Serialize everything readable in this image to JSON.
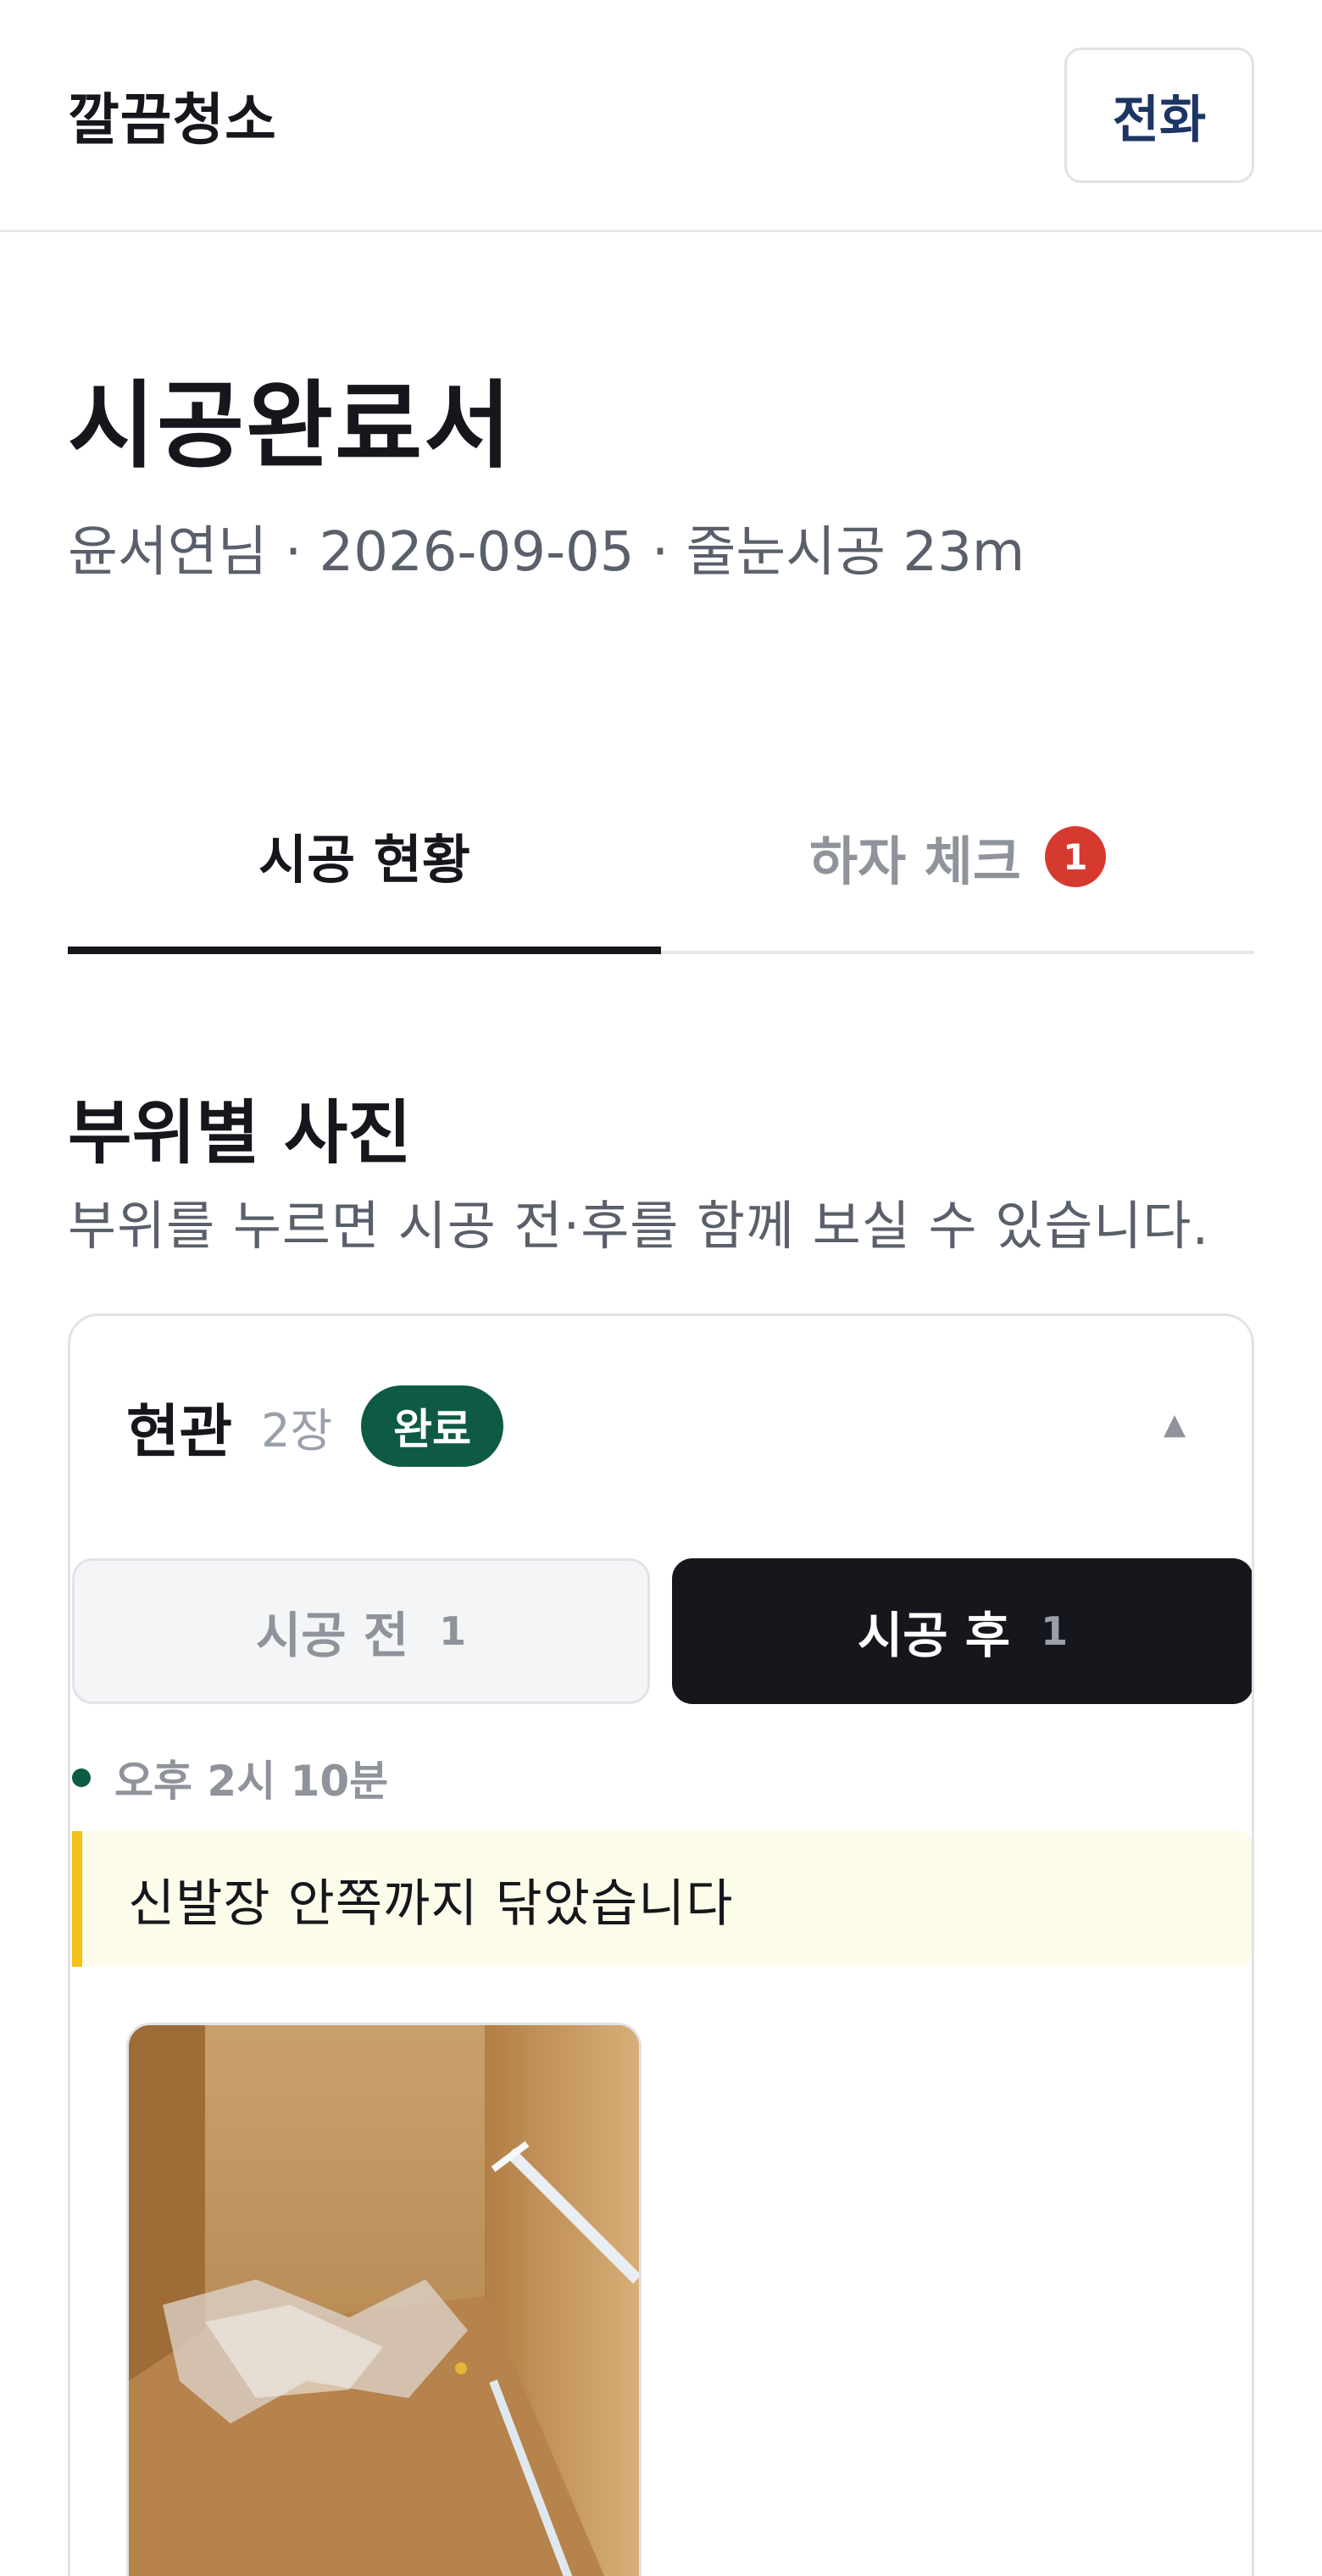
{
  "header": {
    "brand": "깔끔청소",
    "call_label": "전화"
  },
  "page": {
    "title": "시공완료서",
    "meta": "윤서연님 · 2026-09-05 · 줄눈시공 23m"
  },
  "tabs": [
    {
      "label": "시공 현황",
      "active": true
    },
    {
      "label": "하자 체크",
      "badge": "1",
      "active": false
    }
  ],
  "section": {
    "title": "부위별 사진",
    "subtitle": "부위를 누르면 시공 전·후를 함께 보실 수 있습니다."
  },
  "area": {
    "name": "현관",
    "count": "2장",
    "status": "완료",
    "toggle_icon": "▲",
    "segments": [
      {
        "label": "시공 전",
        "count": "1",
        "active": false
      },
      {
        "label": "시공 후",
        "count": "1",
        "active": true
      }
    ],
    "entry": {
      "time": "오후 2시 10분",
      "memo": "신발장 안쪽까지 닦았습니다"
    },
    "photo_icon": "photo-thumbnail"
  },
  "colors": {
    "accent_green": "#0e5a45",
    "badge_red": "#d63a2f",
    "memo_yellow": "#f2c21b",
    "navy": "#1c3562"
  }
}
